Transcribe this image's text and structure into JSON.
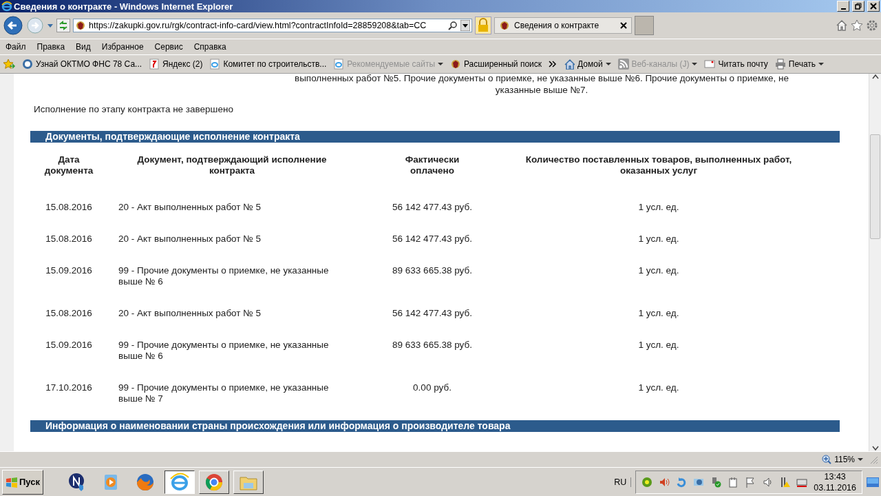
{
  "window": {
    "title": "Сведения о контракте - Windows Internet Explorer"
  },
  "address_bar": {
    "url": "https://zakupki.gov.ru/rgk/contract-info-card/view.html?contractInfoId=28859208&tab=CC"
  },
  "tabs": [
    {
      "label": "Сведения о контракте",
      "selected": true
    }
  ],
  "menu": [
    "Файл",
    "Правка",
    "Вид",
    "Избранное",
    "Сервис",
    "Справка"
  ],
  "favorites": [
    {
      "label": "Узнай ОКТМО  ФНС  78 Са...",
      "disabled": false
    },
    {
      "label": "Яндекс (2)",
      "disabled": false
    },
    {
      "label": "Комитет по строительств...",
      "disabled": false
    },
    {
      "label": "Рекомендуемые сайты",
      "disabled": true
    },
    {
      "label": "Расширенный поиск",
      "disabled": false
    }
  ],
  "command_bar": [
    {
      "label": "Домой",
      "disabled": false
    },
    {
      "label": "Веб-каналы (J)",
      "disabled": true
    },
    {
      "label": "Читать почту",
      "disabled": false
    },
    {
      "label": "Печать",
      "disabled": false
    }
  ],
  "page": {
    "partial_lines": [
      "выполненных работ №5. Прочие документы о приемке, не указанные выше №6. Прочие документы о приемке, не",
      "указанные выше №7."
    ],
    "status_text": "Исполнение по этапу контракта не завершено",
    "sections": [
      {
        "title": "Документы, подтверждающие исполнение контракта",
        "table": {
          "columns": [
            "Дата документа",
            "Документ, подтверждающий исполнение контракта",
            "Фактически оплачено",
            "Количество поставленных товаров, выполненных работ, оказанных услуг"
          ],
          "rows": [
            [
              "15.08.2016",
              "20 - Акт выполненных работ № 5",
              "56 142 477.43 руб.",
              "1 усл. ед."
            ],
            [
              "15.08.2016",
              "20 - Акт выполненных работ № 5",
              "56 142 477.43 руб.",
              "1 усл. ед."
            ],
            [
              "15.09.2016",
              "99 - Прочие документы о приемке, не указанные выше № 6",
              "89 633 665.38 руб.",
              "1 усл. ед."
            ],
            [
              "15.08.2016",
              "20 - Акт выполненных работ № 5",
              "56 142 477.43 руб.",
              "1 усл. ед."
            ],
            [
              "15.09.2016",
              "99 - Прочие документы о приемке, не указанные выше № 6",
              "89 633 665.38 руб.",
              "1 усл. ед."
            ],
            [
              "17.10.2016",
              "99 - Прочие документы о приемке, не указанные выше № 7",
              "0.00 руб.",
              "1 усл. ед."
            ]
          ]
        }
      },
      {
        "title": "Информация о наименовании страны происхождения или информация о производителе товара"
      }
    ]
  },
  "status_bar": {
    "zoom": "115%"
  },
  "taskbar": {
    "start": "Пуск",
    "language": "RU",
    "time": "13:43",
    "date": "03.11.2016"
  }
}
